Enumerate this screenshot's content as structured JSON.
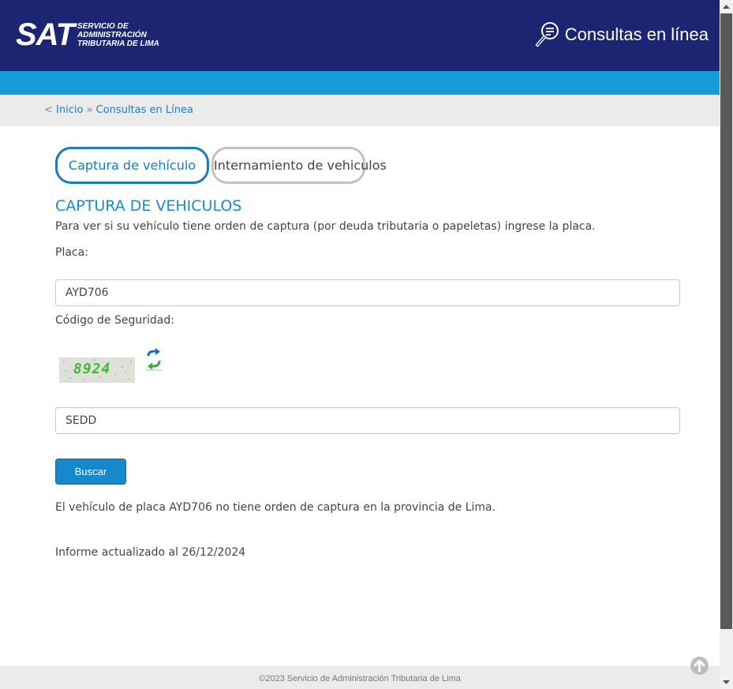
{
  "header": {
    "logo_main": "SAT",
    "logo_line1": "Servicio de",
    "logo_line2": "Administración",
    "logo_line3": "Tributaria de Lima",
    "section_title": "Consultas en línea"
  },
  "breadcrumb": {
    "prefix": "< ",
    "home": "Inicio",
    "separator": " » ",
    "current": "Consultas en Línea"
  },
  "tabs": [
    {
      "label": "Captura de vehículo",
      "active": true
    },
    {
      "label": "Internamiento de vehiculos",
      "active": false
    }
  ],
  "form": {
    "title": "CAPTURA DE VEHICULOS",
    "description": "Para ver si su vehículo tiene orden de captura (por deuda tributaria o papeletas) ingrese la placa.",
    "plate_label": "Placa:",
    "plate_value": "AYD706",
    "security_label": "Código de Seguridad:",
    "captcha_text": "8924",
    "security_value": "SEDD",
    "search_button": "Buscar"
  },
  "result": {
    "message": "El vehículo de placa AYD706 no tiene orden de captura en la provincia de Lima.",
    "updated": "Informe actualizado al 26/12/2024"
  },
  "footer": {
    "copyright": "©2023 Servicio de Administración Tributaria de Lima"
  },
  "colors": {
    "header_bg": "#1b2572",
    "accent_bar": "#159bd8",
    "link": "#1f7fc0",
    "button": "#1888cc"
  },
  "icons": {
    "search_consult": "magnifier-document-icon",
    "captcha_refresh": "refresh-arrows-icon",
    "back_to_top": "arrow-up-circle-icon"
  }
}
